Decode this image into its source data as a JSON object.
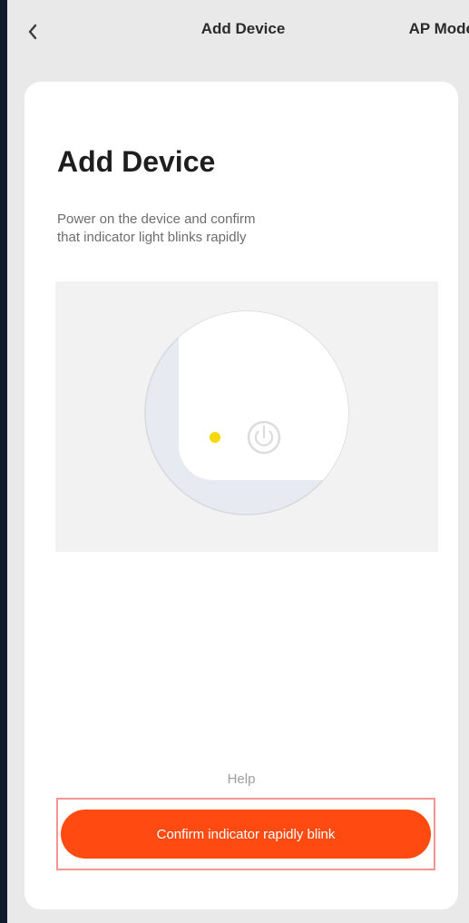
{
  "navbar": {
    "back_icon": "chevron-left-icon",
    "title": "Add Device",
    "action_label": "AP Mode"
  },
  "card": {
    "title": "Add Device",
    "description_line1": "Power on the device and confirm",
    "description_line2": "that indicator light blinks rapidly",
    "illustration_icons": [
      "indicator-light-icon",
      "power-icon"
    ],
    "help_label": "Help",
    "confirm_label": "Confirm indicator rapidly blink"
  },
  "colors": {
    "background": "#0f1b2d",
    "screen": "#e9e9ea",
    "card": "#ffffff",
    "primary_button": "#ff4b12",
    "highlight_border": "#f5958f",
    "indicator_light": "#f5d90a"
  }
}
